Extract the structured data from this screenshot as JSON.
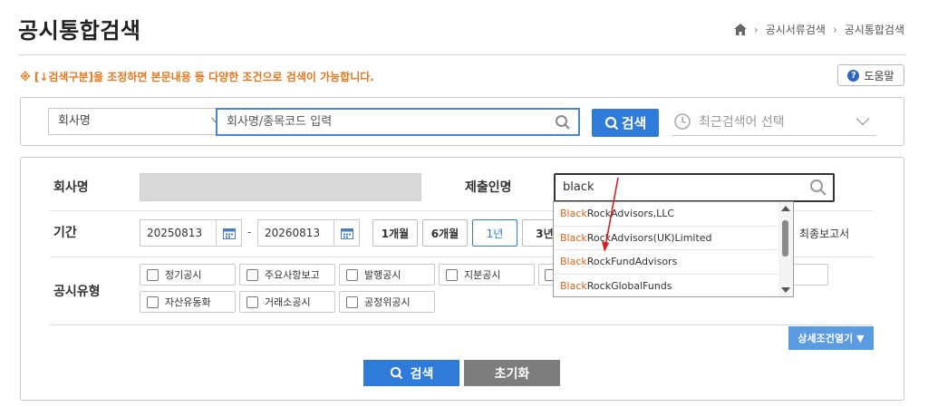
{
  "header": {
    "title": "공시통합검색",
    "breadcrumb": [
      "공시서류검색",
      "공시통합검색"
    ]
  },
  "notice": "※ [↓검색구분]을 조정하면 본문내용 등 다양한 조건으로 검색이 가능합니다.",
  "help_label": "도움말",
  "search_bar": {
    "type_select": "회사명",
    "input_placeholder": "회사명/종목코드 입력",
    "search_label": "검색",
    "recent_placeholder": "최근검색어 선택"
  },
  "filters": {
    "company_label": "회사명",
    "submitter_label": "제출인명",
    "submitter_value": "black",
    "period_label": "기간",
    "date_from": "20250813",
    "date_to": "20260813",
    "period_buttons": [
      "1개월",
      "6개월",
      "1년",
      "3년"
    ],
    "active_period": "1년",
    "final_report_label": "최종보고서",
    "disclosure_type_label": "공시유형",
    "disclosure_types_row1": [
      "정기공시",
      "주요사항보고",
      "발행공시",
      "지분공시"
    ],
    "disclosure_types_row2": [
      "자산유동화",
      "거래소공시",
      "공정위공시"
    ],
    "detail_toggle_label": "상세조건열기",
    "search_button": "검색",
    "reset_button": "초기화"
  },
  "autocomplete": {
    "highlight": "Black",
    "items": [
      {
        "match": "Black",
        "rest": "RockAdvisors,LLC"
      },
      {
        "match": "Black",
        "rest": "RockAdvisors(UK)Limited"
      },
      {
        "match": "Black",
        "rest": "RockFundAdvisors"
      },
      {
        "match": "Black",
        "rest": "RockGlobalFunds"
      }
    ]
  },
  "colors": {
    "primary": "#2f7bd9",
    "notice": "#e8761c",
    "highlight": "#e0641c",
    "annotation_arrow": "#d42020"
  },
  "icons": [
    "home-icon",
    "search-icon",
    "clock-icon",
    "calendar-icon",
    "help-icon",
    "chevron-down-icon"
  ]
}
